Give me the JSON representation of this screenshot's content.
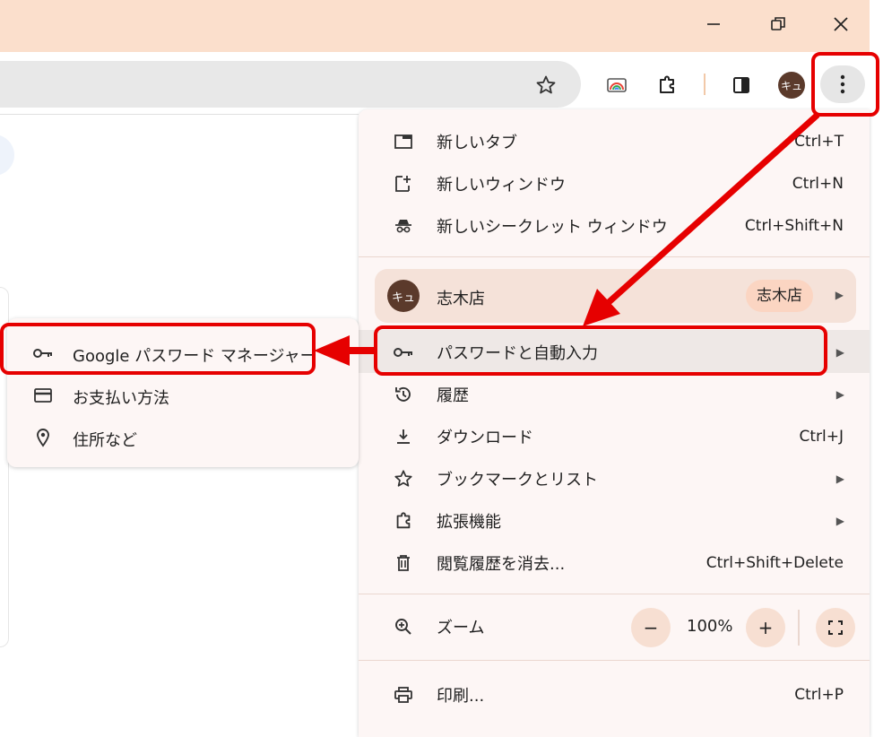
{
  "window": {
    "minimize_icon": "minimize-icon",
    "restore_icon": "restore-icon",
    "close_icon": "close-icon"
  },
  "toolbar": {
    "bookmark_icon": "star-icon",
    "cast_icon": "media-icon",
    "extensions_icon": "puzzle-icon",
    "side_panel_icon": "side-panel-icon",
    "profile_avatar": "キュ",
    "menu_icon": "kebab-menu-icon"
  },
  "menu": {
    "items": [
      {
        "label": "新しいタブ",
        "shortcut": "Ctrl+T"
      },
      {
        "label": "新しいウィンドウ",
        "shortcut": "Ctrl+N"
      },
      {
        "label": "新しいシークレット ウィンドウ",
        "shortcut": "Ctrl+Shift+N"
      }
    ],
    "profile": {
      "avatar": "キュ",
      "name": "志木店",
      "badge": "志木店"
    },
    "items2": [
      {
        "label": "パスワードと自動入力"
      },
      {
        "label": "履歴"
      },
      {
        "label": "ダウンロード",
        "shortcut": "Ctrl+J"
      },
      {
        "label": "ブックマークとリスト"
      },
      {
        "label": "拡張機能"
      },
      {
        "label": "閲覧履歴を消去...",
        "shortcut": "Ctrl+Shift+Delete"
      }
    ],
    "zoom": {
      "label": "ズーム",
      "minus": "−",
      "value": "100%",
      "plus": "+"
    },
    "print": {
      "label": "印刷...",
      "shortcut": "Ctrl+P"
    }
  },
  "submenu": {
    "items": [
      {
        "label": "Google パスワード マネージャー"
      },
      {
        "label": "お支払い方法"
      },
      {
        "label": "住所など"
      }
    ]
  },
  "colors": {
    "highlight": "#e60000",
    "titlebar": "#fbdfcc",
    "menu_bg": "#fdf6f5"
  }
}
